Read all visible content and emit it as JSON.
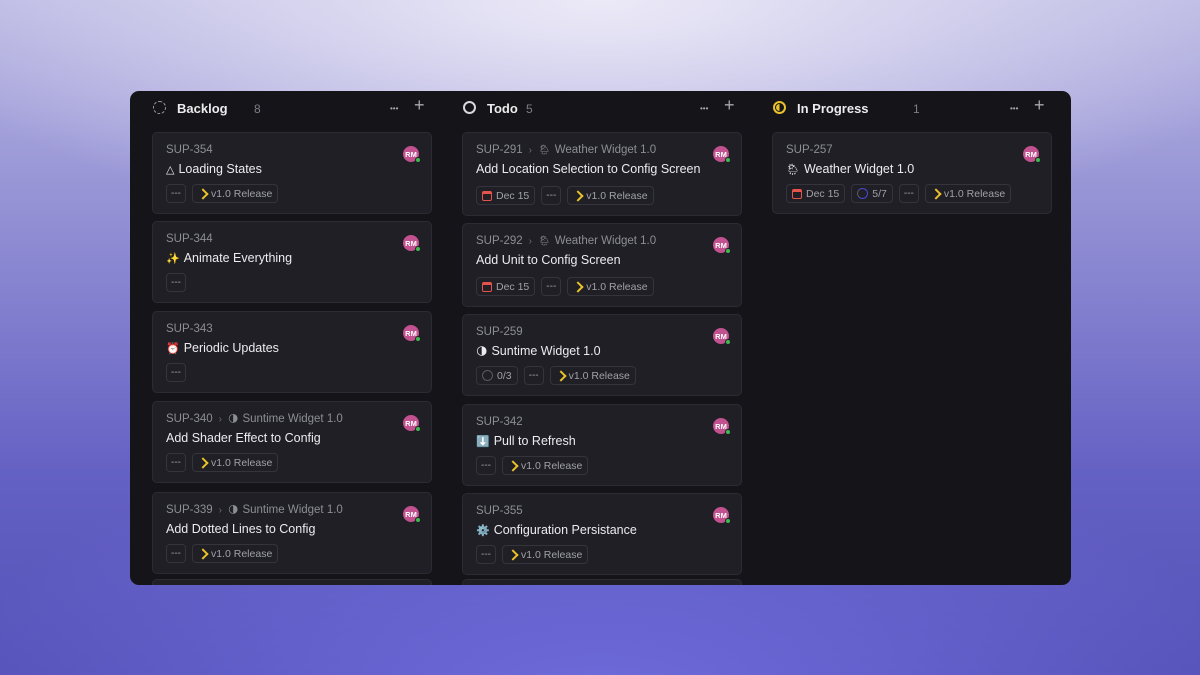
{
  "avatar_initials": "RM",
  "release_label": "v1.0 Release",
  "columns": [
    {
      "title": "Backlog",
      "count": "8",
      "cards": [
        {
          "id": "SUP-354",
          "icon": "△",
          "title": "Loading States",
          "tags": [
            "dots",
            "release"
          ]
        },
        {
          "id": "SUP-344",
          "icon": "✨",
          "title": "Animate Everything",
          "tags": [
            "dots"
          ]
        },
        {
          "id": "SUP-343",
          "icon": "⏰",
          "title": "Periodic Updates",
          "tags": [
            "dots"
          ]
        },
        {
          "id": "SUP-340",
          "parent_icon": "🌗",
          "parent": "Suntime Widget 1.0",
          "title": "Add Shader Effect to Config",
          "tags": [
            "dots",
            "release"
          ]
        },
        {
          "id": "SUP-339",
          "parent_icon": "🌗",
          "parent": "Suntime Widget 1.0",
          "title": "Add Dotted Lines to Config",
          "tags": [
            "dots",
            "release"
          ]
        }
      ]
    },
    {
      "title": "Todo",
      "count": "5",
      "cards": [
        {
          "id": "SUP-291",
          "parent_icon": "🌦",
          "parent": "Weather Widget 1.0",
          "title": "Add Location Selection to Config Screen",
          "date": "Dec 15",
          "tags": [
            "date",
            "dots",
            "release"
          ]
        },
        {
          "id": "SUP-292",
          "parent_icon": "🌦",
          "parent": "Weather Widget 1.0",
          "title": "Add Unit to Config Screen",
          "date": "Dec 15",
          "tags": [
            "date",
            "dots",
            "release"
          ]
        },
        {
          "id": "SUP-259",
          "icon": "🌗",
          "title": "Suntime Widget 1.0",
          "progress": "0/3",
          "tags": [
            "progress",
            "dots",
            "release"
          ]
        },
        {
          "id": "SUP-342",
          "icon": "⬇️",
          "title": "Pull to Refresh",
          "tags": [
            "dots",
            "release"
          ]
        },
        {
          "id": "SUP-355",
          "icon": "⚙️",
          "title": "Configuration Persistance",
          "tags": [
            "dots",
            "release"
          ]
        }
      ]
    },
    {
      "title": "In Progress",
      "count": "1",
      "cards": [
        {
          "id": "SUP-257",
          "icon": "🌦",
          "title": "Weather Widget 1.0",
          "date": "Dec 15",
          "progress": "5/7",
          "tags": [
            "date",
            "progress-partial",
            "dots",
            "release"
          ]
        }
      ]
    }
  ],
  "colors": {
    "backlog_icon": "#9a9aa2",
    "todo_icon": "#d7d7dc",
    "progress_icon": "#e9c12a",
    "avatar": "#c2518f",
    "release_icon": "#e9c12a",
    "date_icon": "#e5534b"
  }
}
